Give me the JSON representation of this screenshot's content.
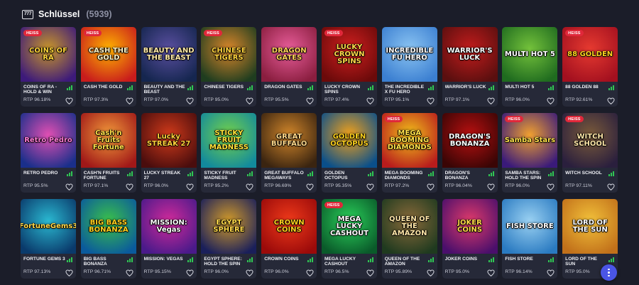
{
  "header": {
    "icon": "slot-777-icon",
    "title": "Schlüssel",
    "count": "(5939)"
  },
  "colors": {
    "background": "#1b1d29",
    "card": "#262938",
    "hot_badge": "#e0283a",
    "signal": "#2fc653",
    "fab": "#4a55e6"
  },
  "games": [
    {
      "name": "COINS OF RA - HOLD & WIN",
      "rtp": "RTP 96.18%",
      "hot": "HEISS",
      "logo": "COINS OF RA",
      "bg": [
        "#3d1a7a",
        "#c9962a"
      ],
      "fg": "#ffd43b"
    },
    {
      "name": "CASH THE GOLD",
      "rtp": "RTP 97.3%",
      "hot": "HEISS",
      "logo": "CASH THE GOLD",
      "bg": [
        "#c81c1c",
        "#ffb300"
      ],
      "fg": "#fff3c4"
    },
    {
      "name": "BEAUTY AND THE BEAST",
      "rtp": "RTP 97.0%",
      "hot": "",
      "logo": "BEAUTY AND THE BEAST",
      "bg": [
        "#15264f",
        "#5a4fa0"
      ],
      "fg": "#ffe9a8"
    },
    {
      "name": "CHINESE TIGERS",
      "rtp": "RTP 95.0%",
      "hot": "HEISS",
      "logo": "CHINESE TIGERS",
      "bg": [
        "#1f3d1f",
        "#d9862a"
      ],
      "fg": "#ffd23d"
    },
    {
      "name": "DRAGON GATES",
      "rtp": "RTP 95.5%",
      "hot": "",
      "logo": "DRAGON GATES",
      "bg": [
        "#8a1e3f",
        "#e85d9a"
      ],
      "fg": "#ffd25a"
    },
    {
      "name": "LUCKY CROWN SPINS",
      "rtp": "RTP 97.4%",
      "hot": "HEISS",
      "logo": "LUCKY CROWN SPINS",
      "bg": [
        "#6b0a0a",
        "#d01f1f"
      ],
      "fg": "#ffd84a"
    },
    {
      "name": "THE INCREDIBLE X FU HERO",
      "rtp": "RTP 95.1%",
      "hot": "",
      "logo": "INCREDIBLE FU HERO",
      "bg": [
        "#3b7fd1",
        "#8bc4f2"
      ],
      "fg": "#ffffff"
    },
    {
      "name": "WARRIOR'S LUCK",
      "rtp": "RTP 97.1%",
      "hot": "",
      "logo": "WARRIOR'S LUCK",
      "bg": [
        "#5a0f0f",
        "#c21c1c"
      ],
      "fg": "#ffffff"
    },
    {
      "name": "MULTI HOT 5",
      "rtp": "RTP 96.0%",
      "hot": "",
      "logo": "MULTI HOT 5",
      "bg": [
        "#1f6b1f",
        "#74c23b"
      ],
      "fg": "#ffffff"
    },
    {
      "name": "88 GOLDEN 88",
      "rtp": "RTP 92.61%",
      "hot": "HEISS",
      "logo": "88 GOLDEN",
      "bg": [
        "#a3101f",
        "#e63a30"
      ],
      "fg": "#ffd21f"
    },
    {
      "name": "RETRO PEDRO",
      "rtp": "RTP 95.5%",
      "hot": "",
      "logo": "Retro Pedro",
      "bg": [
        "#1a2f8a",
        "#e04fb3"
      ],
      "fg": "#ff7ad6"
    },
    {
      "name": "CASH'N FRUITS FORTUNE",
      "rtp": "RTP 97.1%",
      "hot": "",
      "logo": "Cash'n Fruits Fortune",
      "bg": [
        "#a01818",
        "#f29a3a"
      ],
      "fg": "#ffe14a"
    },
    {
      "name": "LUCKY STREAK 27",
      "rtp": "RTP 96.0%",
      "hot": "",
      "logo": "Lucky STREAK 27",
      "bg": [
        "#4a0d0d",
        "#d03a1a"
      ],
      "fg": "#ffd03a"
    },
    {
      "name": "STICKY FRUIT MADNESS",
      "rtp": "RTP 95.2%",
      "hot": "",
      "logo": "STICKY FRUIT MADNESS",
      "bg": [
        "#128a9c",
        "#74d14a"
      ],
      "fg": "#ffe33a"
    },
    {
      "name": "GREAT BUFFALO MEGAWAYS",
      "rtp": "RTP 96.69%",
      "hot": "",
      "logo": "GREAT BUFFALO",
      "bg": [
        "#3a2410",
        "#d1862a"
      ],
      "fg": "#ffd88a"
    },
    {
      "name": "GOLDEN OCTOPUS",
      "rtp": "RTP 95.35%",
      "hot": "",
      "logo": "GOLDEN OCTOPUS",
      "bg": [
        "#0a4f8a",
        "#f2a11a"
      ],
      "fg": "#ffd21f"
    },
    {
      "name": "MEGA BOOMING DIAMONDS",
      "rtp": "RTP 97.2%",
      "hot": "HEISS",
      "logo": "MEGA BOOMING DIAMONDS",
      "bg": [
        "#b81c1c",
        "#f2c21a"
      ],
      "fg": "#ffe14a"
    },
    {
      "name": "DRAGON'S BONANZA",
      "rtp": "RTP 96.04%",
      "hot": "",
      "logo": "DRAGON'S BONANZA",
      "bg": [
        "#3a0505",
        "#b81010"
      ],
      "fg": "#ffffff"
    },
    {
      "name": "SAMBA STARS: HOLD THE SPIN",
      "rtp": "RTP 96.0%",
      "hot": "HEISS",
      "logo": "Samba Stars",
      "bg": [
        "#3a1a7a",
        "#f0a030"
      ],
      "fg": "#ffe14a"
    },
    {
      "name": "WITCH SCHOOL",
      "rtp": "RTP 97.11%",
      "hot": "HEISS",
      "logo": "WITCH SCHOOL",
      "bg": [
        "#2a1f3d",
        "#7a5a3a"
      ],
      "fg": "#ffe6a8"
    },
    {
      "name": "FORTUNE GEMS 3",
      "rtp": "RTP 97.13%",
      "hot": "",
      "logo": "FortuneGems3",
      "bg": [
        "#0a3a6b",
        "#2ab8d1"
      ],
      "fg": "#ffd84a"
    },
    {
      "name": "BIG BASS BONANZA",
      "rtp": "RTP 96.71%",
      "hot": "",
      "logo": "BIG BASS BONANZA",
      "bg": [
        "#0a5a9c",
        "#3ac14a"
      ],
      "fg": "#ffd21f"
    },
    {
      "name": "MISSION: VEGAS",
      "rtp": "RTP 95.15%",
      "hot": "",
      "logo": "MISSION: Vegas",
      "bg": [
        "#4a1a8a",
        "#d12a9a"
      ],
      "fg": "#ffffff"
    },
    {
      "name": "EGYPT SPHERE: HOLD THE SPIN",
      "rtp": "RTP 96.0%",
      "hot": "",
      "logo": "EGYPT SPHERE",
      "bg": [
        "#1a1f5a",
        "#d19a2a"
      ],
      "fg": "#ffd84a"
    },
    {
      "name": "CROWN COINS",
      "rtp": "RTP 96.0%",
      "hot": "",
      "logo": "CROWN COINS",
      "bg": [
        "#9a0a0a",
        "#f03a1a"
      ],
      "fg": "#ffd21f"
    },
    {
      "name": "MEGA LUCKY CASHOUT",
      "rtp": "RTP 96.5%",
      "hot": "HEISS",
      "logo": "MEGA LUCKY CASHOUT",
      "bg": [
        "#0a5a2a",
        "#2ad15a"
      ],
      "fg": "#ffffff"
    },
    {
      "name": "QUEEN OF THE AMAZON",
      "rtp": "RTP 95.89%",
      "hot": "",
      "logo": "QUEEN OF THE AMAZON",
      "bg": [
        "#1f3a1f",
        "#8a6a3a"
      ],
      "fg": "#ffe6a8"
    },
    {
      "name": "JOKER COINS",
      "rtp": "RTP 95.0%",
      "hot": "",
      "logo": "JOKER COINS",
      "bg": [
        "#4a0f6b",
        "#e03a6b"
      ],
      "fg": "#ffd84a"
    },
    {
      "name": "FISH STORE",
      "rtp": "RTP 96.14%",
      "hot": "",
      "logo": "FISH STORE",
      "bg": [
        "#2a7ac1",
        "#9ad1f2"
      ],
      "fg": "#ffffff"
    },
    {
      "name": "LORD OF THE SUN",
      "rtp": "RTP 95.0%",
      "hot": "",
      "logo": "LORD OF THE SUN",
      "bg": [
        "#c1701a",
        "#f2c13a"
      ],
      "fg": "#ffffff"
    }
  ],
  "fab": {
    "icon": "more-vertical-icon"
  }
}
